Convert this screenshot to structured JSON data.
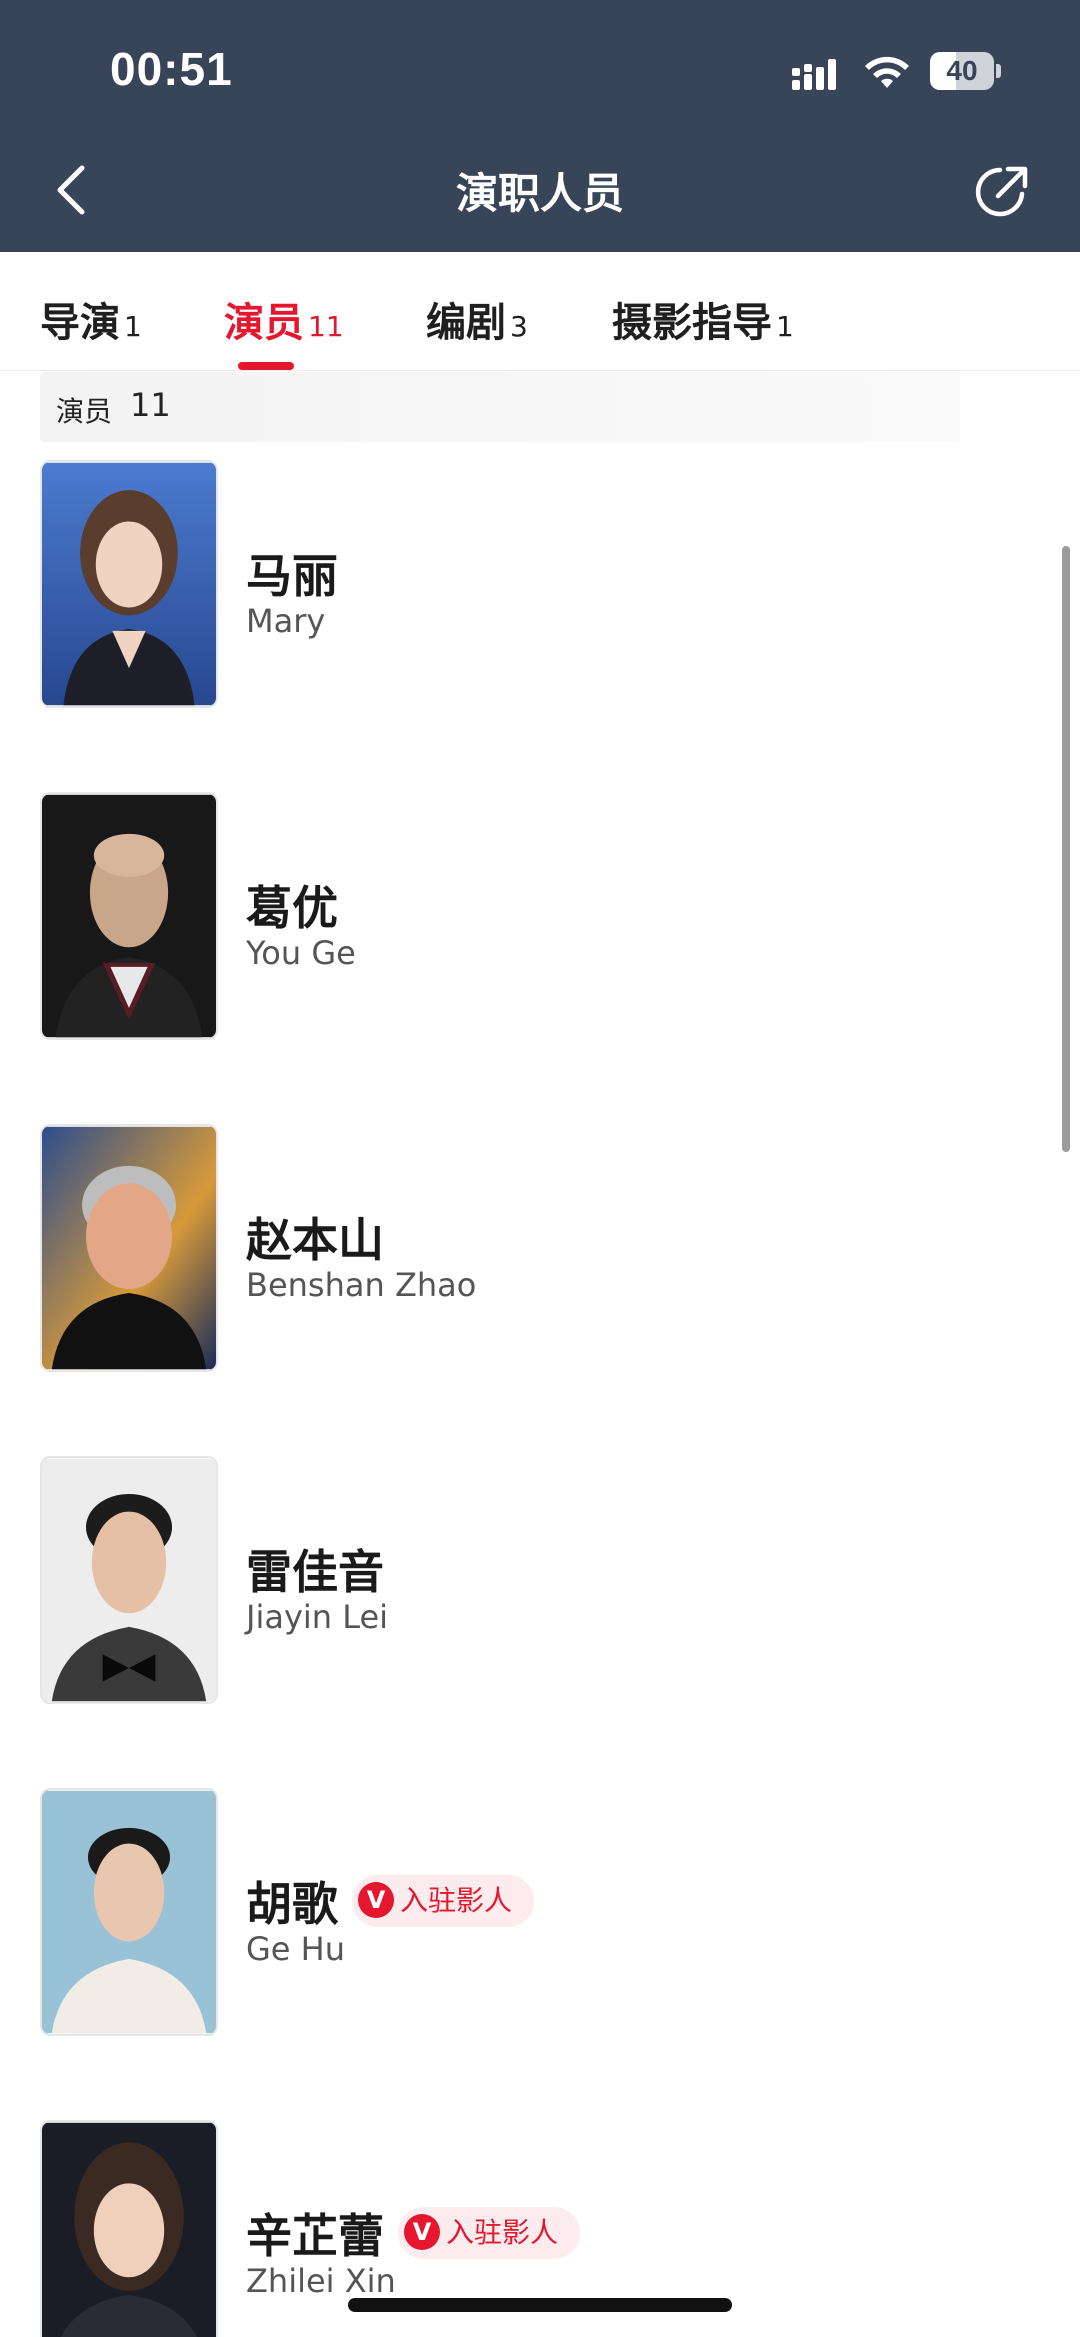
{
  "status_bar": {
    "time": "00:51",
    "battery": "40",
    "battery_level": 0.4,
    "icons": [
      "signal-icon",
      "wifi-icon",
      "battery-icon"
    ]
  },
  "nav": {
    "title": "演职人员",
    "icons": [
      "back-icon",
      "share-icon"
    ]
  },
  "tabs": [
    {
      "label": "导演",
      "count": "1",
      "active": false
    },
    {
      "label": "演员",
      "count": "11",
      "active": true
    },
    {
      "label": "编剧",
      "count": "3",
      "active": false
    },
    {
      "label": "摄影指导",
      "count": "1",
      "active": false
    }
  ],
  "section": {
    "label": "演员",
    "count": "11"
  },
  "cast": [
    {
      "name_cn": "马丽",
      "name_en": "Mary",
      "badge": ""
    },
    {
      "name_cn": "葛优",
      "name_en": "You Ge",
      "badge": ""
    },
    {
      "name_cn": "赵本山",
      "name_en": "Benshan Zhao",
      "badge": ""
    },
    {
      "name_cn": "雷佳音",
      "name_en": "Jiayin Lei",
      "badge": ""
    },
    {
      "name_cn": "胡歌",
      "name_en": "Ge Hu",
      "badge": "入驻影人",
      "badge_icon": "V"
    },
    {
      "name_cn": "辛芷蕾",
      "name_en": "Zhilei Xin",
      "badge": "入驻影人",
      "badge_icon": "V"
    }
  ],
  "colors": {
    "header_bg": "#384559",
    "accent": "#e5172f",
    "badge_bg": "#fdecee"
  }
}
